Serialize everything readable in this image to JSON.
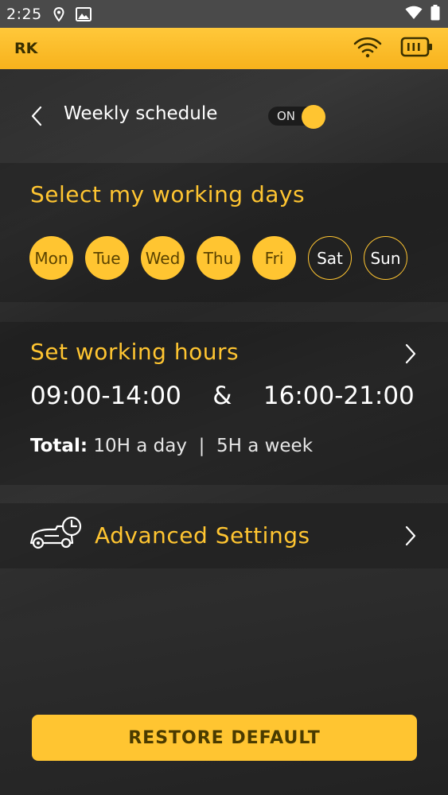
{
  "status_bar": {
    "time": "2:25",
    "icons": [
      "location-icon",
      "gallery-icon",
      "wifi-icon",
      "battery-icon"
    ]
  },
  "app_header": {
    "device_name": "RK",
    "icons": [
      "wifi-signal-icon",
      "battery-level-icon"
    ],
    "background_color": "#ffc531"
  },
  "title_bar": {
    "title": "Weekly schedule",
    "toggle_label": "ON",
    "toggle_state": true
  },
  "working_days": {
    "title": "Select my working days",
    "days": [
      {
        "label": "Mon",
        "selected": true
      },
      {
        "label": "Tue",
        "selected": true
      },
      {
        "label": "Wed",
        "selected": true
      },
      {
        "label": "Thu",
        "selected": true
      },
      {
        "label": "Fri",
        "selected": true
      },
      {
        "label": "Sat",
        "selected": false
      },
      {
        "label": "Sun",
        "selected": false
      }
    ]
  },
  "working_hours": {
    "title": "Set working hours",
    "range1": "09:00-14:00",
    "separator": "&",
    "range2": "16:00-21:00",
    "total_label": "Total:",
    "per_day": "10H a day",
    "divider": "|",
    "per_week": "5H a week"
  },
  "advanced": {
    "label": "Advanced Settings",
    "icon": "mower-clock-icon"
  },
  "restore_button": {
    "label": "RESTORE DEFAULT"
  },
  "colors": {
    "accent": "#ffc531",
    "background": "#2a2a2a"
  }
}
